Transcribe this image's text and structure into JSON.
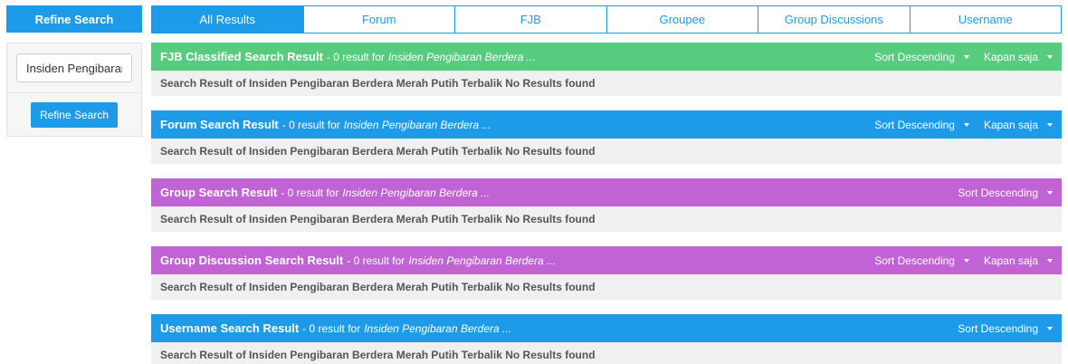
{
  "sidebar": {
    "title": "Refine Search",
    "input_value": "Insiden Pengibaran",
    "button_label": "Refine Search"
  },
  "tabs": [
    {
      "label": "All Results",
      "active": true
    },
    {
      "label": "Forum",
      "active": false
    },
    {
      "label": "FJB",
      "active": false
    },
    {
      "label": "Groupee",
      "active": false
    },
    {
      "label": "Group Discussions",
      "active": false
    },
    {
      "label": "Username",
      "active": false
    }
  ],
  "colors": {
    "blue": "#1e9be8",
    "green": "#58cc7e",
    "purple": "#c163d4",
    "body_bg": "#f0f0f0"
  },
  "sections": [
    {
      "title": "FJB Classified Search Result",
      "meta": "- 0 result for",
      "query": "Insiden Pengibaran Berdera ...",
      "sort_label": "Sort Descending",
      "time_label": "Kapan saja",
      "body": "Search Result of Insiden Pengibaran Berdera Merah Putih Terbalik No Results found"
    },
    {
      "title": "Forum Search Result",
      "meta": "- 0 result for",
      "query": "Insiden Pengibaran Berdera ...",
      "sort_label": "Sort Descending",
      "time_label": "Kapan saja",
      "body": "Search Result of Insiden Pengibaran Berdera Merah Putih Terbalik No Results found"
    },
    {
      "title": "Group Search Result",
      "meta": "- 0 result for",
      "query": "Insiden Pengibaran Berdera ...",
      "sort_label": "Sort Descending",
      "body": "Search Result of Insiden Pengibaran Berdera Merah Putih Terbalik No Results found"
    },
    {
      "title": "Group Discussion Search Result",
      "meta": "- 0 result for",
      "query": "Insiden Pengibaran Berdera ...",
      "sort_label": "Sort Descending",
      "time_label": "Kapan saja",
      "body": "Search Result of Insiden Pengibaran Berdera Merah Putih Terbalik No Results found"
    },
    {
      "title": "Username Search Result",
      "meta": "- 0 result for",
      "query": "Insiden Pengibaran Berdera ...",
      "sort_label": "Sort Descending",
      "body": "Search Result of Insiden Pengibaran Berdera Merah Putih Terbalik No Results found"
    }
  ]
}
